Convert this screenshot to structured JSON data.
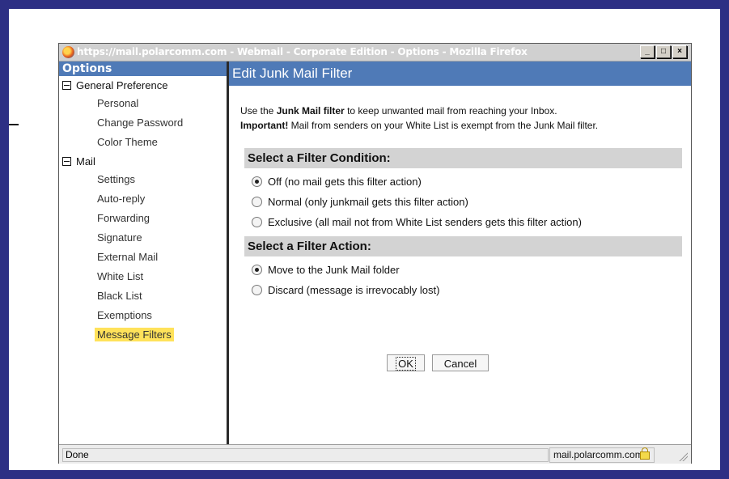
{
  "window": {
    "title": "https://mail.polarcomm.com - Webmail - Corporate Edition - Options - Mozilla Firefox",
    "buttons": {
      "minimize": "_",
      "maximize": "□",
      "close": "×"
    }
  },
  "sidebar": {
    "header": "Options",
    "groups": [
      {
        "label": "General Preference",
        "items": [
          "Personal",
          "Change Password",
          "Color Theme"
        ]
      },
      {
        "label": "Mail",
        "items": [
          "Settings",
          "Auto-reply",
          "Forwarding",
          "Signature",
          "External Mail",
          "White List",
          "Black List",
          "Exemptions",
          "Message Filters"
        ]
      }
    ],
    "selected": "Message Filters",
    "highlight_color": "#ffe25a"
  },
  "main": {
    "title": "Edit Junk Mail Filter",
    "intro": {
      "line1_prefix": "Use the ",
      "line1_bold": "Junk Mail filter",
      "line1_suffix": " to keep unwanted mail from reaching your Inbox.",
      "line2_bold": "Important!",
      "line2_suffix": " Mail from senders on your White List is exempt from the Junk Mail filter."
    },
    "condition": {
      "heading": "Select a Filter Condition:",
      "options": [
        {
          "label": "Off (no mail gets this filter action)",
          "checked": true
        },
        {
          "label": "Normal (only junkmail gets this filter action)",
          "checked": false
        },
        {
          "label": "Exclusive (all mail not from White List senders gets this filter action)",
          "checked": false
        }
      ]
    },
    "action": {
      "heading": "Select a Filter Action:",
      "options": [
        {
          "label": "Move to the Junk Mail folder",
          "checked": true
        },
        {
          "label": "Discard (message is irrevocably lost)",
          "checked": false
        }
      ]
    },
    "buttons": {
      "ok": "OK",
      "cancel": "Cancel"
    }
  },
  "status": {
    "text": "Done",
    "domain": "mail.polarcomm.com"
  },
  "colors": {
    "header_blue": "#4f7ab7",
    "frame": "#2d2f84",
    "section_gray": "#d3d3d3"
  }
}
